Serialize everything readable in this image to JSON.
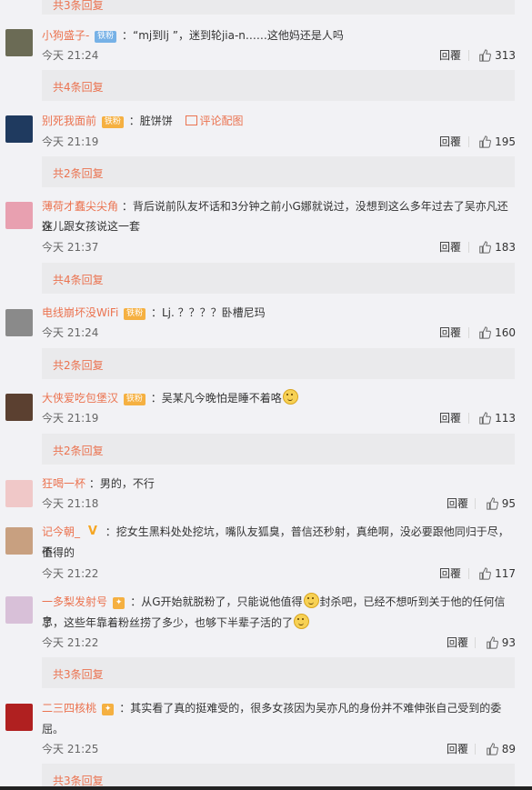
{
  "top_partial": {
    "label": "共3条回复"
  },
  "reply_label": "回覆",
  "comments": [
    {
      "name": "小狗盛子-",
      "badge": "铁粉",
      "badge_type": "iron",
      "text": "：“mj到lj ”，迷到轮jia-n……这他妈还是人吗",
      "time": "今天 21:24",
      "likes": "313",
      "sub": "共4条回复"
    },
    {
      "name": "别死我面前",
      "badge": "铁粉",
      "badge_type": "gold",
      "text": "：脏饼饼",
      "pic_link": "评论配图",
      "time": "今天 21:19",
      "likes": "195",
      "sub": "共2条回复"
    },
    {
      "name": "薄荷才蠢尖尖角",
      "text": "：背后说前队友坏话和3分钟之前小G娜就说过，没想到这么多年过去了吴亦凡还在",
      "text2": "这儿跟女孩说这一套",
      "time": "今天 21:37",
      "likes": "183",
      "sub": "共4条回复"
    },
    {
      "name": "电线崩坏没WiFi",
      "badge": "铁粉",
      "badge_type": "gold",
      "text": "：Lj. ？？？？卧槽尼玛",
      "time": "今天 21:24",
      "likes": "160",
      "sub": "共2条回复"
    },
    {
      "name": "大侠爱吃包堡汉",
      "badge": "铁粉",
      "badge_type": "gold",
      "text": "：吴某凡今晚怕是睡不着咯",
      "time": "今天 21:19",
      "likes": "113",
      "sub": "共2条回复"
    },
    {
      "name": "狂喝一杯",
      "text": "：男的，不行",
      "time": "今天 21:18",
      "likes": "95"
    },
    {
      "name": "记今朝_",
      "badge": "V",
      "badge_type": "v",
      "text": "：挖女生黑料处处挖坑，嘴队友狐臭，普信还秒射，真绝啊，没必要跟他同归于尽，不",
      "text2": "值得的",
      "time": "今天 21:22",
      "likes": "117"
    },
    {
      "name": "一多梨发射号",
      "badge": "",
      "badge_type": "gold",
      "text": "：从G开始就脱粉了，只能说他值得",
      "text_b": "封杀吧，已经不想听到关于他的任何信息",
      "text2": "了，这些年靠着粉丝捞了多少，也够下半辈子活的了",
      "time": "今天 21:22",
      "likes": "93",
      "sub": "共3条回复"
    },
    {
      "name": "二三四核桃",
      "badge": "",
      "badge_type": "gold",
      "text": "：其实看了真的挺难受的，很多女孩因为吴亦凡的身份并不难伸张自己受到的委",
      "text2": "屈。",
      "time": "今天 21:25",
      "likes": "89",
      "sub": "共3条回复"
    }
  ],
  "avatar_colors": [
    "#6b6b55",
    "#1f3a5f",
    "#e8a0b0",
    "#8a8a8a",
    "#5b4030",
    "#f0c8c8",
    "#c8a080",
    "#d8c0d8",
    "#b02020"
  ]
}
